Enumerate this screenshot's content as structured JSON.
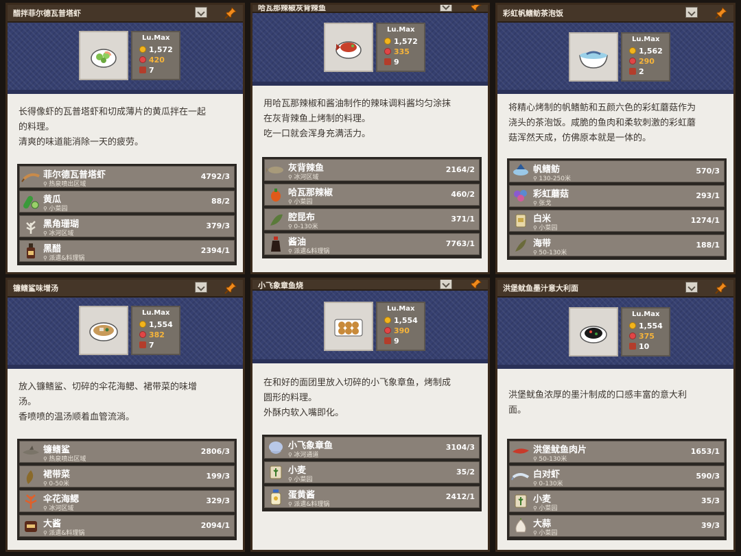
{
  "ui": {
    "level_label": "Lu.Max"
  },
  "cards": [
    {
      "title": "醋拌菲尔德瓦普塔虾",
      "dish_icon": "shrimp-cucumber-salad",
      "price": "1,572",
      "flavor": "420",
      "cost": "7",
      "description": "长得像虾的瓦普塔虾和切成薄片的黄瓜拌在一起\n的料理。\n清爽的味道能消除一天的疲劳。",
      "ingredients": [
        {
          "name": "菲尔德瓦普塔虾",
          "location": "热泉喷出区域",
          "count": "4792/3",
          "icon": "shrimp"
        },
        {
          "name": "黄瓜",
          "location": "小菜园",
          "count": "88/2",
          "icon": "cucumber"
        },
        {
          "name": "黑角珊瑚",
          "location": "冰河区域",
          "count": "379/3",
          "icon": "coral"
        },
        {
          "name": "黑醋",
          "location": "派遣&料理锅",
          "count": "2394/1",
          "icon": "vinegar"
        }
      ]
    },
    {
      "title": "哈瓦那辣椒灰背辣鱼",
      "dish_icon": "spicy-fish",
      "price": "1,572",
      "flavor": "335",
      "cost": "9",
      "description": "用哈瓦那辣椒和酱油制作的辣味调料酱均匀涂抹\n在灰背辣鱼上烤制的料理。\n吃一口就会浑身充满活力。",
      "ingredients": [
        {
          "name": "灰背辣鱼",
          "location": "冰河区域",
          "count": "2164/2",
          "icon": "fish"
        },
        {
          "name": "哈瓦那辣椒",
          "location": "小菜园",
          "count": "460/2",
          "icon": "pepper"
        },
        {
          "name": "腔昆布",
          "location": "0-130米",
          "count": "371/1",
          "icon": "kelp"
        },
        {
          "name": "酱油",
          "location": "派遣&料理锅",
          "count": "7763/1",
          "icon": "soy-sauce"
        }
      ]
    },
    {
      "title": "彩虹帆鳍鲂茶泡饭",
      "dish_icon": "fish-rice-bowl",
      "price": "1,562",
      "flavor": "290",
      "cost": "2",
      "description": "将精心烤制的帆鳍鲂和五颜六色的彩虹蘑菇作为\n浇头的茶泡饭。咸脆的鱼肉和柔软刺激的彩虹蘑\n菇浑然天成，仿佛原本就是一体的。",
      "ingredients": [
        {
          "name": "帆鳍鲂",
          "location": "130-250米",
          "count": "570/3",
          "icon": "sailfin"
        },
        {
          "name": "彩虹蘑菇",
          "location": "张戈",
          "count": "293/1",
          "icon": "mushroom"
        },
        {
          "name": "白米",
          "location": "小菜园",
          "count": "1274/1",
          "icon": "rice"
        },
        {
          "name": "海带",
          "location": "50-130米",
          "count": "188/1",
          "icon": "seaweed"
        }
      ]
    },
    {
      "title": "镰鳍鲨味增汤",
      "dish_icon": "miso-soup",
      "price": "1,554",
      "flavor": "382",
      "cost": "7",
      "description": "放入镰鳍鲨、切碎的伞花海鳃、裙带菜的味增\n汤。\n香喷喷的温汤顺着血管流淌。",
      "ingredients": [
        {
          "name": "镰鳍鲨",
          "location": "热泉喷出区域",
          "count": "2806/3",
          "icon": "shark"
        },
        {
          "name": "裙带菜",
          "location": "0-50米",
          "count": "199/3",
          "icon": "wakame"
        },
        {
          "name": "伞花海鳃",
          "location": "冰河区域",
          "count": "329/3",
          "icon": "sea-pen"
        },
        {
          "name": "大酱",
          "location": "派遣&料理锅",
          "count": "2094/1",
          "icon": "soybean-paste"
        }
      ]
    },
    {
      "title": "小飞象章鱼烧",
      "dish_icon": "takoyaki",
      "price": "1,554",
      "flavor": "390",
      "cost": "9",
      "description": "在和好的面团里放入切碎的小飞象章鱼，烤制成\n圆形的料理。\n外酥内软入嘴即化。",
      "ingredients": [
        {
          "name": "小飞象章鱼",
          "location": "冰河通道",
          "count": "3104/3",
          "icon": "dumbo-octopus"
        },
        {
          "name": "小麦",
          "location": "小菜园",
          "count": "35/2",
          "icon": "wheat"
        },
        {
          "name": "蛋黄酱",
          "location": "派遣&料理锅",
          "count": "2412/1",
          "icon": "mayonnaise"
        }
      ]
    },
    {
      "title": "洪堡鱿鱼墨汁意大利面",
      "dish_icon": "squid-ink-pasta",
      "price": "1,554",
      "flavor": "375",
      "cost": "10",
      "description": "洪堡鱿鱼浓厚的墨汁制成的口感丰富的意大利\n面。",
      "ingredients": [
        {
          "name": "洪堡鱿鱼肉片",
          "location": "50-130米",
          "count": "1653/1",
          "icon": "squid"
        },
        {
          "name": "白对虾",
          "location": "0-130米",
          "count": "590/3",
          "icon": "white-shrimp"
        },
        {
          "name": "小麦",
          "location": "小菜园",
          "count": "35/3",
          "icon": "wheat"
        },
        {
          "name": "大蒜",
          "location": "小菜园",
          "count": "39/3",
          "icon": "garlic"
        }
      ]
    }
  ],
  "colors": {
    "header": "#453628",
    "banner": "#364070",
    "card_bg": "#efede8",
    "ingredient_bg": "#8a8178",
    "flavor_accent": "#f6b43a"
  }
}
